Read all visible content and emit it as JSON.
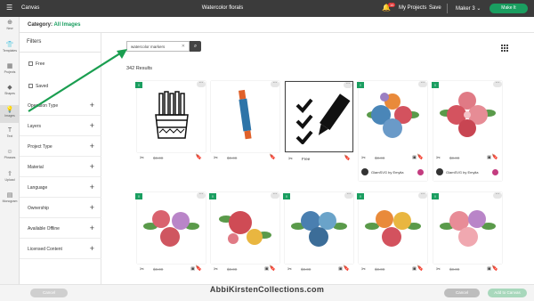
{
  "topbar": {
    "app_name": "Canvas",
    "doc_title": "Watercolor florals",
    "notification_count": "16",
    "my_projects": "My Projects",
    "save": "Save",
    "machine": "Maker 3",
    "make_button": "Make It"
  },
  "toolbar": [
    {
      "label": "New",
      "icon": "plus-icon"
    },
    {
      "label": "Templates",
      "icon": "shirt-icon"
    },
    {
      "label": "Projects",
      "icon": "projects-icon"
    },
    {
      "label": "Shapes",
      "icon": "shapes-icon"
    },
    {
      "label": "Images",
      "icon": "lightbulb-icon"
    },
    {
      "label": "Text",
      "icon": "text-icon"
    },
    {
      "label": "Phrases",
      "icon": "phrases-icon"
    },
    {
      "label": "Upload",
      "icon": "upload-icon"
    },
    {
      "label": "Monogram",
      "icon": "monogram-icon"
    }
  ],
  "header": {
    "category_label": "Category:",
    "category_value": "All Images"
  },
  "filters": {
    "title": "Filters",
    "checks": [
      "Free",
      "Saved"
    ],
    "sections": [
      "Operation Type",
      "Layers",
      "Project Type",
      "Material",
      "Language",
      "Ownership",
      "Available Offline",
      "Licensed Content"
    ]
  },
  "search": {
    "value": "watercolor markers"
  },
  "results_text": "342 Results",
  "cards": [
    {
      "price": "$0.00",
      "free": false,
      "author": ""
    },
    {
      "price": "$0.00",
      "free": false,
      "author": ""
    },
    {
      "price": "Free",
      "free": true,
      "author": ""
    },
    {
      "price": "$0.00",
      "free": false,
      "author": "GlamSVG by Emylia"
    },
    {
      "price": "$0.00",
      "free": false,
      "author": "GlamSVG by Emylia"
    },
    {
      "price": "$0.00",
      "free": false,
      "author": ""
    },
    {
      "price": "$0.00",
      "free": false,
      "author": ""
    },
    {
      "price": "$0.00",
      "free": false,
      "author": ""
    },
    {
      "price": "$0.00",
      "free": false,
      "author": ""
    },
    {
      "price": "$0.00",
      "free": false,
      "author": ""
    }
  ],
  "bottombar": {
    "left": "Cancel",
    "cancel": "Cancel",
    "add": "Add to Canvas"
  },
  "watermark": "AbbiKirstenCollections.com",
  "colors": {
    "accent": "#1a9e60",
    "topbar": "#3b3b3b",
    "arrow": "#1a9e50"
  }
}
